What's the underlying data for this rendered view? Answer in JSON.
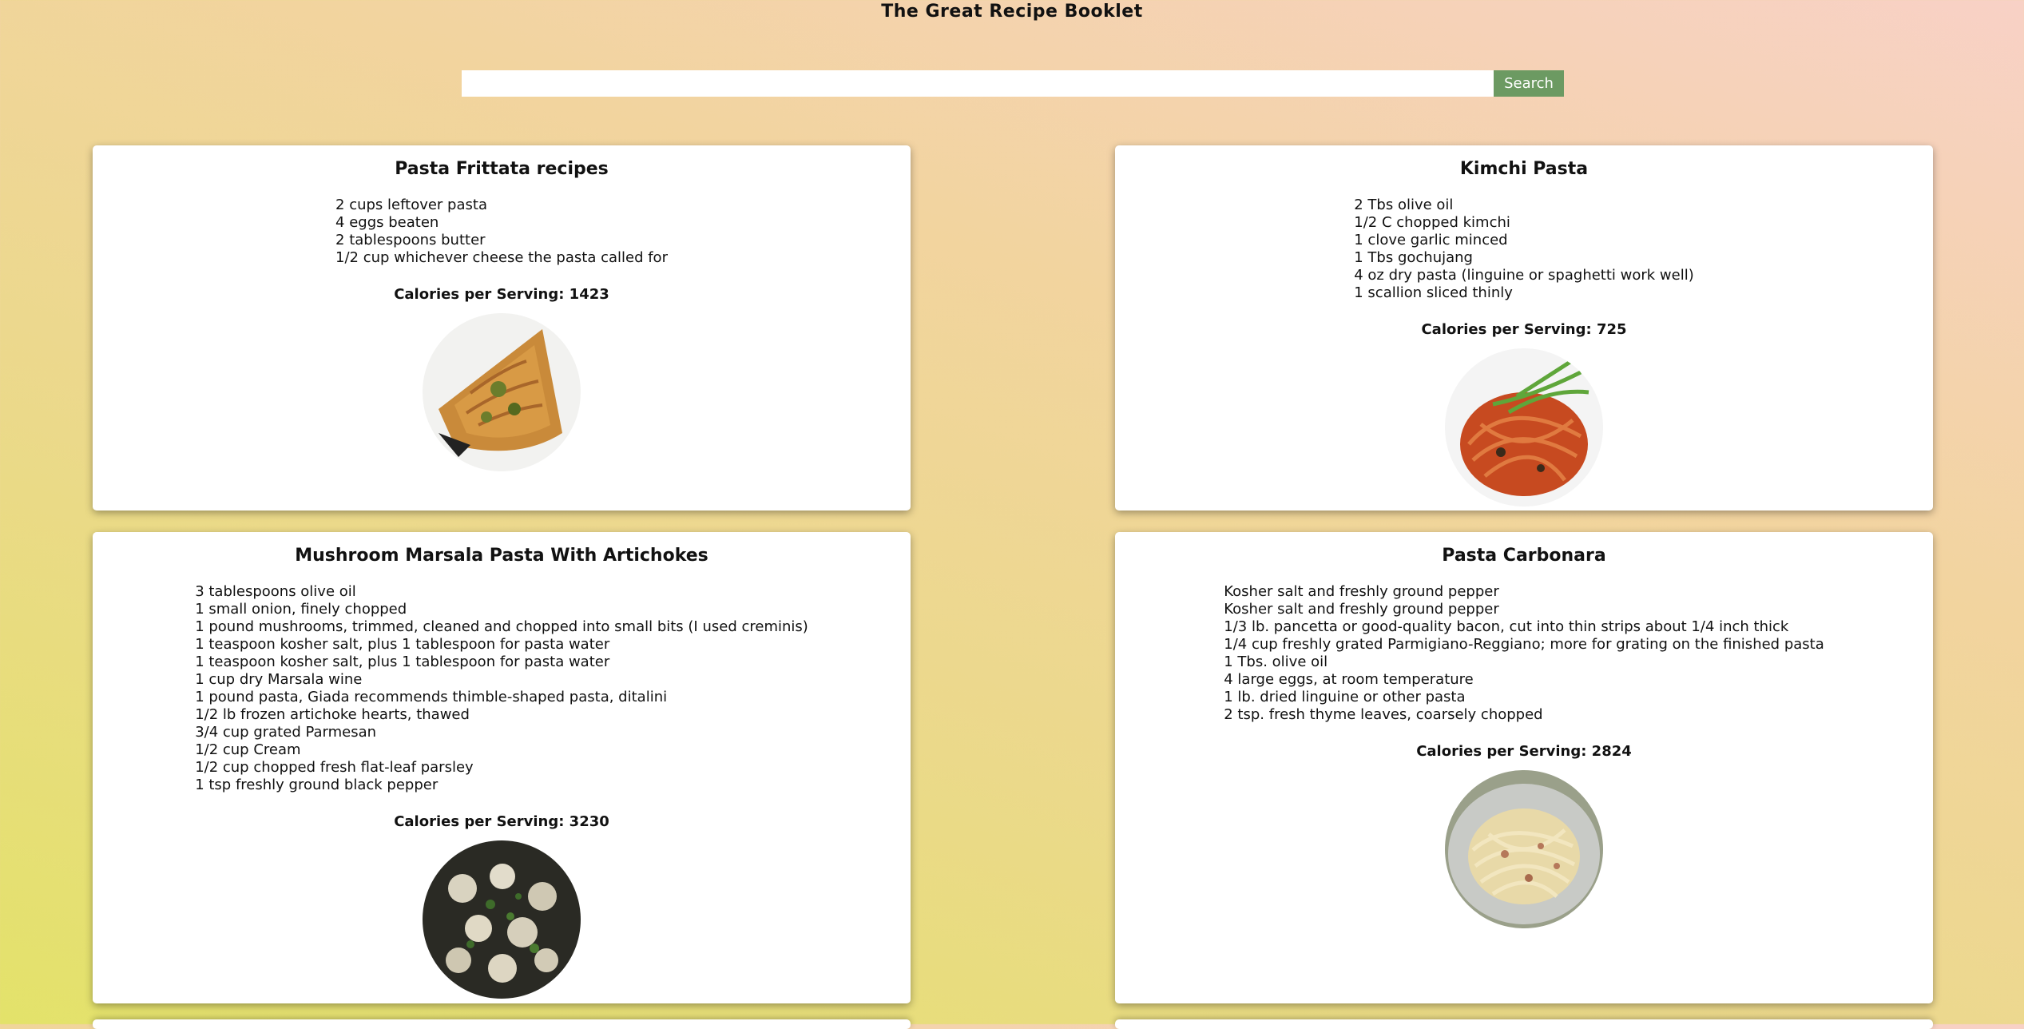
{
  "header": {
    "title": "The Great Recipe Booklet"
  },
  "search": {
    "placeholder": "",
    "value": "",
    "button_label": "Search"
  },
  "recipes": [
    {
      "title": "Pasta Frittata recipes",
      "ingredients": [
        "2 cups leftover pasta",
        "4 eggs beaten",
        "2 tablespoons butter",
        "1/2 cup whichever cheese the pasta called for"
      ],
      "calories_label": "Calories per Serving: 1423"
    },
    {
      "title": "Kimchi Pasta",
      "ingredients": [
        "2 Tbs olive oil",
        "1/2 C chopped kimchi",
        "1 clove garlic minced",
        "1 Tbs gochujang",
        "4 oz dry pasta (linguine or spaghetti work well)",
        "1 scallion sliced thinly"
      ],
      "calories_label": "Calories per Serving: 725"
    },
    {
      "title": "Mushroom Marsala Pasta With Artichokes",
      "ingredients": [
        "3 tablespoons olive oil",
        "1 small onion, finely chopped",
        "1 pound mushrooms, trimmed, cleaned and chopped into small bits (I used creminis)",
        "1 teaspoon kosher salt, plus 1 tablespoon for pasta water",
        "1 teaspoon kosher salt, plus 1 tablespoon for pasta water",
        "1 cup dry Marsala wine",
        "1 pound pasta, Giada recommends thimble-shaped pasta, ditalini",
        "1/2 lb frozen artichoke hearts, thawed",
        "3/4 cup grated Parmesan",
        "1/2 cup Cream",
        "1/2 cup chopped fresh flat-leaf parsley",
        "1 tsp freshly ground black pepper"
      ],
      "calories_label": "Calories per Serving: 3230"
    },
    {
      "title": "Pasta Carbonara",
      "ingredients": [
        "Kosher salt and freshly ground pepper",
        "Kosher salt and freshly ground pepper",
        "1/3 lb. pancetta or good-quality bacon, cut into thin strips about 1/4 inch thick",
        "1/4 cup freshly grated Parmigiano-Reggiano; more for grating on the finished pasta",
        "1 Tbs. olive oil",
        "4 large eggs, at room temperature",
        "1 lb. dried linguine or other pasta",
        "2 tsp. fresh thyme leaves, coarsely chopped"
      ],
      "calories_label": "Calories per Serving: 2824"
    }
  ],
  "colors": {
    "accent": "#6c9a62",
    "card_bg": "#ffffff"
  }
}
